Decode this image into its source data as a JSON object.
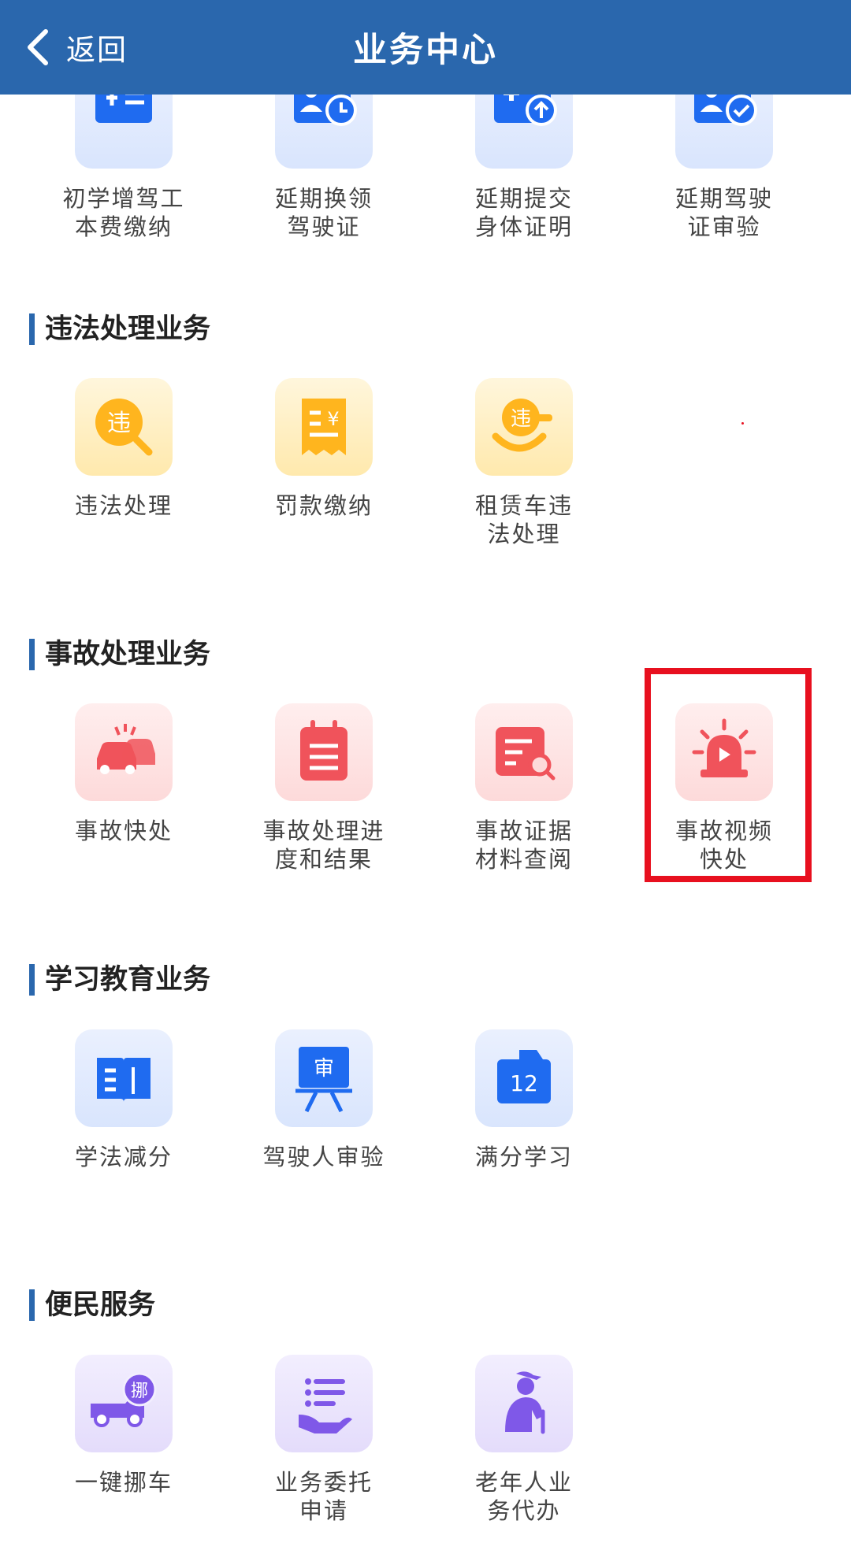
{
  "header": {
    "back_label": "返回",
    "title": "业务中心"
  },
  "sections": [
    {
      "title": "",
      "items": [
        {
          "label_line1": "初学增驾工",
          "label_line2": "本费缴纳",
          "icon": "fee-card-icon",
          "color": "#1f6bf0"
        },
        {
          "label_line1": "延期换领",
          "label_line2": "驾驶证",
          "icon": "license-clock-icon",
          "color": "#1f6bf0"
        },
        {
          "label_line1": "延期提交",
          "label_line2": "身体证明",
          "icon": "medical-upload-icon",
          "color": "#1f6bf0"
        },
        {
          "label_line1": "延期驾驶",
          "label_line2": "证审验",
          "icon": "license-check-icon",
          "color": "#1f6bf0"
        }
      ]
    },
    {
      "title": "违法处理业务",
      "items": [
        {
          "label_line1": "违法处理",
          "label_line2": "",
          "icon": "violation-search-icon",
          "color": "#ffb51e"
        },
        {
          "label_line1": "罚款缴纳",
          "label_line2": "",
          "icon": "fine-receipt-icon",
          "color": "#ffb51e"
        },
        {
          "label_line1": "租赁车违",
          "label_line2": "法处理",
          "icon": "rental-violation-icon",
          "color": "#ffb51e"
        }
      ]
    },
    {
      "title": "事故处理业务",
      "items": [
        {
          "label_line1": "事故快处",
          "label_line2": "",
          "icon": "car-crash-icon",
          "color": "#f0535b"
        },
        {
          "label_line1": "事故处理进",
          "label_line2": "度和结果",
          "icon": "progress-list-icon",
          "color": "#f0535b"
        },
        {
          "label_line1": "事故证据",
          "label_line2": "材料查阅",
          "icon": "evidence-search-icon",
          "color": "#f0535b"
        },
        {
          "label_line1": "事故视频",
          "label_line2": "快处",
          "icon": "alarm-video-icon",
          "color": "#f0535b"
        }
      ]
    },
    {
      "title": "学习教育业务",
      "items": [
        {
          "label_line1": "学法减分",
          "label_line2": "",
          "icon": "book-icon",
          "color": "#1f6bf0"
        },
        {
          "label_line1": "驾驶人审验",
          "label_line2": "",
          "icon": "review-board-icon",
          "color": "#1f6bf0"
        },
        {
          "label_line1": "满分学习",
          "label_line2": "",
          "icon": "calendar-12-icon",
          "color": "#1f6bf0"
        }
      ]
    },
    {
      "title": "便民服务",
      "items": [
        {
          "label_line1": "一键挪车",
          "label_line2": "",
          "icon": "move-truck-icon",
          "color": "#7f58e8"
        },
        {
          "label_line1": "业务委托",
          "label_line2": "申请",
          "icon": "delegate-hand-icon",
          "color": "#7f58e8"
        },
        {
          "label_line1": "老年人业",
          "label_line2": "务代办",
          "icon": "elderly-icon",
          "color": "#7f58e8"
        }
      ]
    }
  ],
  "highlight": {
    "color": "#e8101f",
    "target": "事故视频快处"
  }
}
